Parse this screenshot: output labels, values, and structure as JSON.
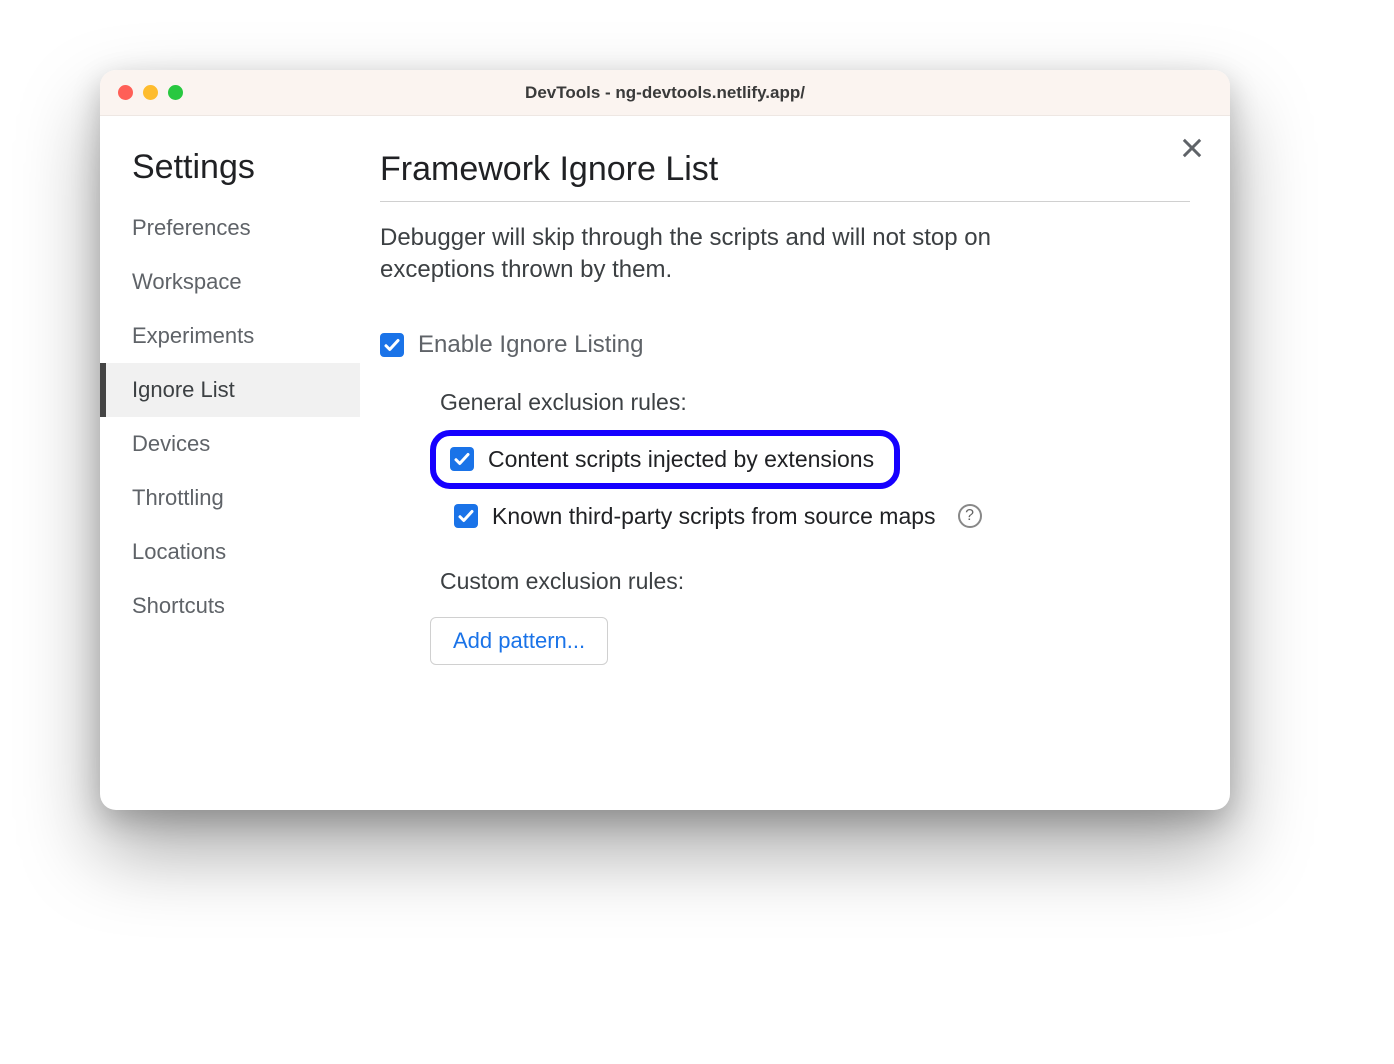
{
  "window": {
    "title": "DevTools - ng-devtools.netlify.app/"
  },
  "sidebar": {
    "title": "Settings",
    "items": [
      {
        "label": "Preferences",
        "active": false
      },
      {
        "label": "Workspace",
        "active": false
      },
      {
        "label": "Experiments",
        "active": false
      },
      {
        "label": "Ignore List",
        "active": true
      },
      {
        "label": "Devices",
        "active": false
      },
      {
        "label": "Throttling",
        "active": false
      },
      {
        "label": "Locations",
        "active": false
      },
      {
        "label": "Shortcuts",
        "active": false
      }
    ]
  },
  "main": {
    "title": "Framework Ignore List",
    "description": "Debugger will skip through the scripts and will not stop on exceptions thrown by them.",
    "enable_label": "Enable Ignore Listing",
    "enable_checked": true,
    "general_section": "General exclusion rules:",
    "rule_content_scripts": "Content scripts injected by extensions",
    "rule_content_scripts_checked": true,
    "rule_content_scripts_highlighted": true,
    "rule_third_party": "Known third-party scripts from source maps",
    "rule_third_party_checked": true,
    "custom_section": "Custom exclusion rules:",
    "add_pattern_label": "Add pattern..."
  },
  "colors": {
    "accent": "#1a73e8",
    "highlight_border": "#1600ff"
  }
}
